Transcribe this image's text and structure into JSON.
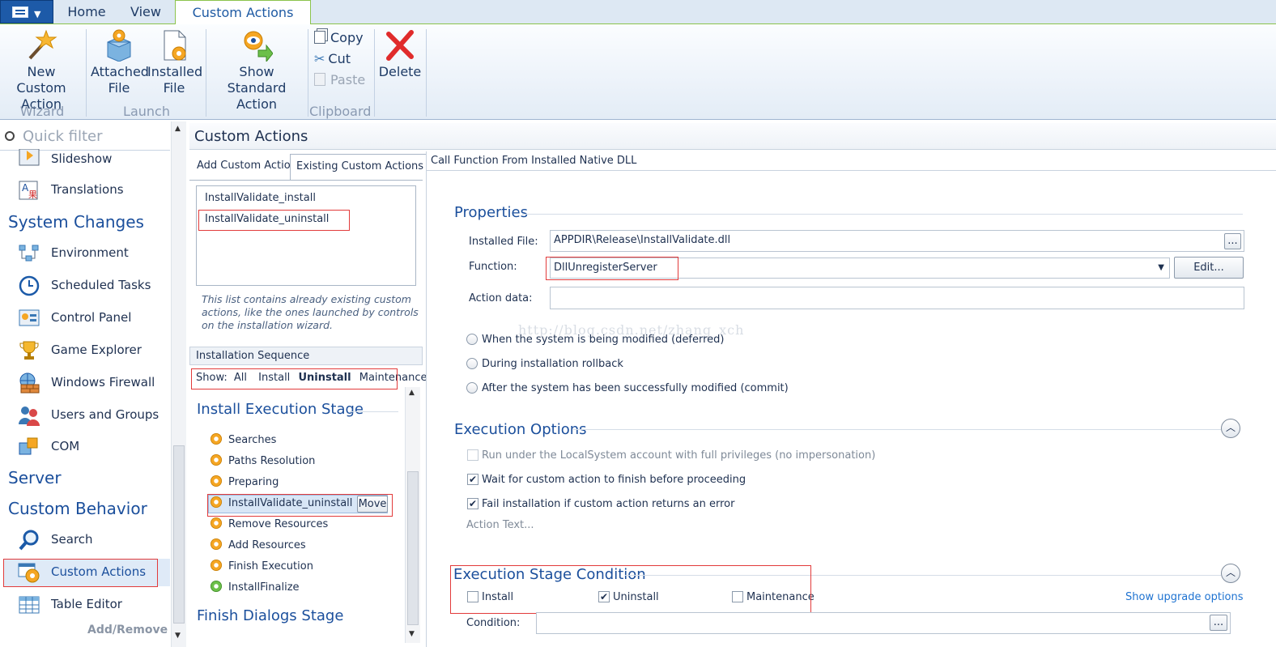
{
  "ribbon_tabs": [
    "Home",
    "View",
    "Custom Actions"
  ],
  "ribbon": {
    "new_custom_action": [
      "New Custom",
      "Action"
    ],
    "attached_file": [
      "Attached",
      "File"
    ],
    "installed_file": [
      "Installed",
      "File"
    ],
    "show_standard_action": [
      "Show Standard",
      "Action"
    ],
    "copy": "Copy",
    "cut": "Cut",
    "paste": "Paste",
    "delete": "Delete",
    "groups": [
      "Wizard",
      "Launch",
      "Clipboard"
    ]
  },
  "nav": {
    "quick_filter": "Quick filter",
    "items_top": [
      "Slideshow",
      "Translations"
    ],
    "heading_system": "System Changes",
    "system_items": [
      "Environment",
      "Scheduled Tasks",
      "Control Panel",
      "Game Explorer",
      "Windows Firewall",
      "Users and Groups",
      "COM"
    ],
    "heading_server": "Server",
    "heading_behavior": "Custom Behavior",
    "behavior_items": [
      "Search",
      "Custom Actions",
      "Table Editor"
    ],
    "add_remove": "Add/Remove"
  },
  "page_title": "Custom Actions",
  "mid": {
    "tabs": [
      "Add Custom Action",
      "Existing Custom Actions"
    ],
    "existing": [
      "InstallValidate_install",
      "InstallValidate_uninstall"
    ],
    "hint": "This list contains already existing custom actions, like the ones launched by controls on the installation wizard.",
    "seq_header": "Installation Sequence",
    "show_label": "Show:",
    "show_options": [
      "All",
      "Install",
      "Uninstall",
      "Maintenance"
    ],
    "stage1": "Install Execution Stage",
    "seq_items": [
      "Searches",
      "Paths Resolution",
      "Preparing",
      "InstallValidate_uninstall",
      "Remove Resources",
      "Add Resources",
      "Finish Execution",
      "InstallFinalize"
    ],
    "move": "Move",
    "stage2": "Finish Dialogs Stage"
  },
  "right": {
    "header": "Call Function From Installed Native DLL",
    "properties": "Properties",
    "installed_file_label": "Installed File:",
    "installed_file_value": "APPDIR\\Release\\InstallValidate.dll",
    "function_label": "Function:",
    "function_value": "DllUnregisterServer",
    "edit": "Edit...",
    "browse": "...",
    "action_data_label": "Action data:",
    "radios": [
      "When the system is being modified (deferred)",
      "During installation rollback",
      "After the system has been successfully modified (commit)"
    ],
    "exec_options": "Execution Options",
    "checks": [
      "Run under the LocalSystem account with full privileges (no impersonation)",
      "Wait for custom action to finish before proceeding",
      "Fail installation if custom action returns an error"
    ],
    "action_text": "Action Text...",
    "stage_condition": "Execution Stage Condition",
    "cond_checks": [
      "Install",
      "Uninstall",
      "Maintenance"
    ],
    "show_upgrade": "Show upgrade options",
    "condition_label": "Condition:"
  },
  "watermark": "http://blog.csdn.net/zhang_xch"
}
